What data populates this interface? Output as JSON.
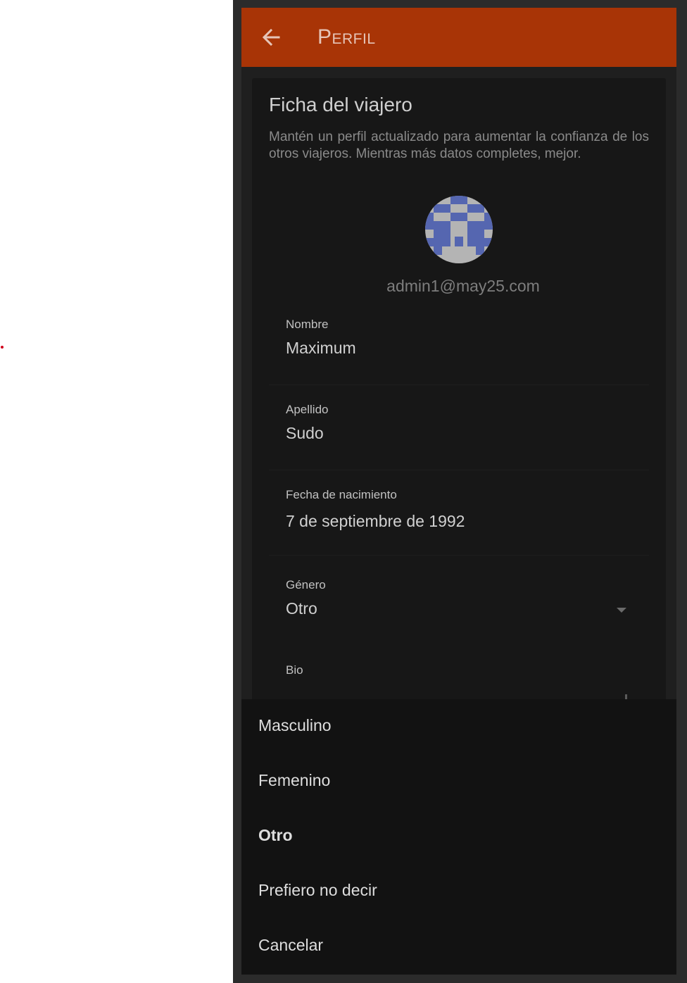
{
  "toolbar": {
    "title": "Perfil",
    "back_icon": "arrow-left-icon"
  },
  "card": {
    "title": "Ficha del viajero",
    "description": "Mantén un perfil actualizado para aumentar la confianza de los otros viajeros. Mientras más datos completes, mejor.",
    "email": "admin1@may25.com"
  },
  "fields": {
    "nombre": {
      "label": "Nombre",
      "value": "Maximum"
    },
    "apellido": {
      "label": "Apellido",
      "value": "Sudo"
    },
    "fecha": {
      "label": "Fecha de nacimiento",
      "value": "7 de septiembre de 1992"
    },
    "genero": {
      "label": "Género",
      "value": "Otro"
    },
    "bio": {
      "label": "Bio"
    }
  },
  "action_sheet": {
    "options": [
      "Masculino",
      "Femenino",
      "Otro",
      "Prefiero no decir"
    ],
    "selected": "Otro",
    "cancel": "Cancelar"
  },
  "colors": {
    "toolbar": "#a83406",
    "avatar_primary": "#5566b0",
    "avatar_bg": "#b4b4b4"
  }
}
